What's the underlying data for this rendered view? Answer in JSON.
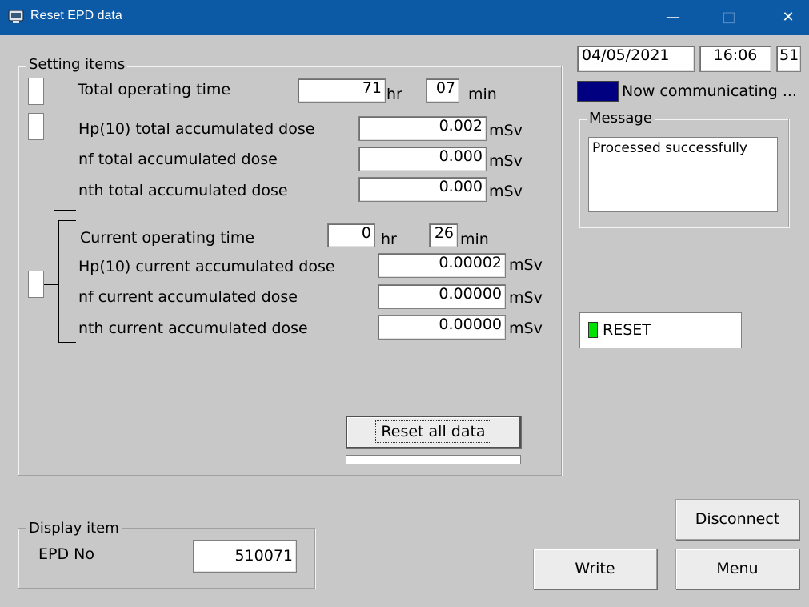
{
  "window": {
    "title": "Reset EPD data",
    "controls": {
      "minimize": "—",
      "maximize": "□",
      "close": "✕"
    }
  },
  "setting_items": {
    "title": "Setting items",
    "total_operating_time": {
      "label": "Total operating time",
      "hours": "71",
      "hr_unit": "hr",
      "minutes": "07",
      "min_unit": "min"
    },
    "total_doses": [
      {
        "label": "Hp(10) total accumulated dose",
        "value": "0.002",
        "unit": "mSv"
      },
      {
        "label": "nf total accumulated dose",
        "value": "0.000",
        "unit": "mSv"
      },
      {
        "label": "nth total accumulated dose",
        "value": "0.000",
        "unit": "mSv"
      }
    ],
    "current_operating_time": {
      "label": "Current operating time",
      "hours": "0",
      "hr_unit": "hr",
      "minutes": "26",
      "min_unit": "min"
    },
    "current_doses": [
      {
        "label": "Hp(10) current accumulated dose",
        "value": "0.00002",
        "unit": "mSv"
      },
      {
        "label": "nf current accumulated dose",
        "value": "0.00000",
        "unit": "mSv"
      },
      {
        "label": "nth current accumulated dose",
        "value": "0.00000",
        "unit": "mSv"
      }
    ],
    "reset_all_label": "Reset all data"
  },
  "status": {
    "date": "04/05/2021",
    "time": "16:06",
    "seconds": "51",
    "comm_text": "Now communicating ...",
    "comm_color": "#000080",
    "message_title": "Message",
    "message_text": "Processed successfully",
    "reset_label": "RESET",
    "reset_color": "#00e000"
  },
  "display_item": {
    "title": "Display item",
    "epd_label": "EPD No",
    "epd_value": "510071"
  },
  "buttons": {
    "disconnect": "Disconnect",
    "write": "Write",
    "menu": "Menu"
  }
}
